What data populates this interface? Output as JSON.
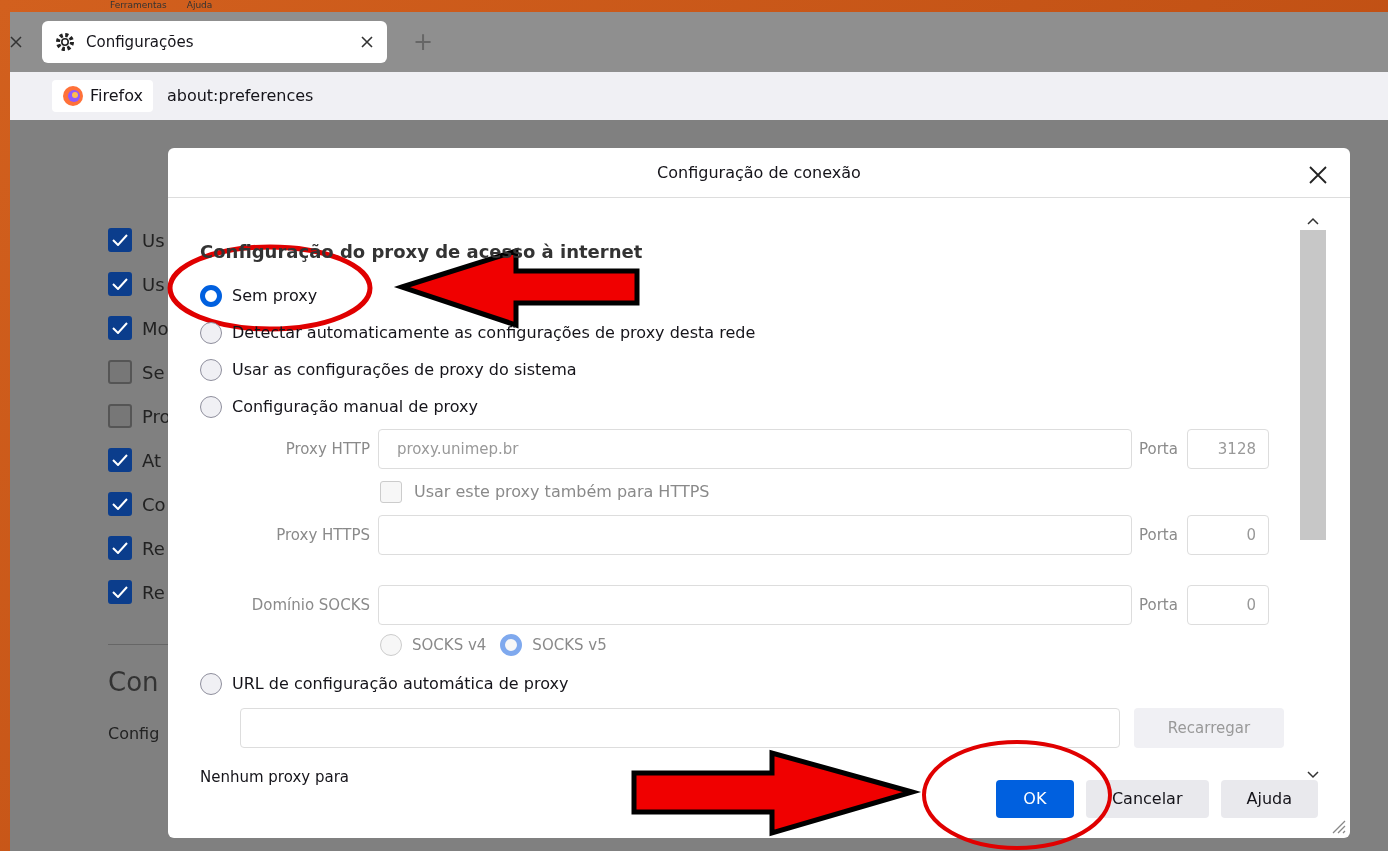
{
  "menu_bar": [
    {
      "label": "Ferramentas"
    },
    {
      "label": "Ajuda"
    }
  ],
  "tabs": [
    {
      "label": "Configurações",
      "selected": true
    }
  ],
  "new_tab": "+",
  "address_bar": {
    "identity": "Firefox",
    "url": "about:preferences"
  },
  "background_page": {
    "checkboxes": [
      {
        "label": "Us",
        "checked": true
      },
      {
        "label": "Us",
        "checked": true
      },
      {
        "label": "Mo",
        "checked": true
      },
      {
        "label": "Se",
        "checked": false
      },
      {
        "label": "Pro",
        "checked": false
      },
      {
        "label": "At",
        "checked": true
      },
      {
        "label": "Co",
        "checked": true
      },
      {
        "label": "Re",
        "checked": true
      },
      {
        "label": "Re",
        "checked": true
      }
    ],
    "section_title": "Con",
    "section_text": "Config"
  },
  "dialog": {
    "title": "Configuração de conexão",
    "heading": "Configuração do proxy de acesso à internet",
    "modes": [
      {
        "label": "Sem proxy",
        "selected": true
      },
      {
        "label": "Detectar automaticamente as configurações de proxy desta rede",
        "selected": false
      },
      {
        "label": "Usar as configurações de proxy do sistema",
        "selected": false
      },
      {
        "label": "Configuração manual de proxy",
        "selected": false,
        "manual": {
          "disabled": true,
          "http": {
            "label": "Proxy HTTP",
            "value": "proxy.unimep.br",
            "port_label": "Porta",
            "port": "3128"
          },
          "also_https": {
            "label": "Usar este proxy também para HTTPS",
            "checked": false
          },
          "https": {
            "label": "Proxy HTTPS",
            "port_label": "Porta",
            "port": "0"
          },
          "socks": {
            "label": "Domínio SOCKS",
            "port_label": "Porta",
            "port": "0"
          },
          "socks_versions": [
            {
              "label": "SOCKS v4",
              "selected": false
            },
            {
              "label": "SOCKS v5",
              "selected": true
            }
          ]
        }
      },
      {
        "label": "URL de configuração automática de proxy",
        "selected": false,
        "autoconfig": {
          "disabled": true,
          "button": "Recarregar"
        }
      }
    ],
    "no_proxy_label": "Nenhum proxy para",
    "buttons": [
      {
        "label": "OK",
        "kind": "primary"
      },
      {
        "label": "Cancelar",
        "kind": "default"
      },
      {
        "label": "Ajuda",
        "kind": "default"
      }
    ]
  },
  "annotations": [
    {
      "kind": "ellipse-top"
    },
    {
      "kind": "arrow-left"
    },
    {
      "kind": "arrow-right"
    },
    {
      "kind": "ellipse-bottom"
    }
  ]
}
